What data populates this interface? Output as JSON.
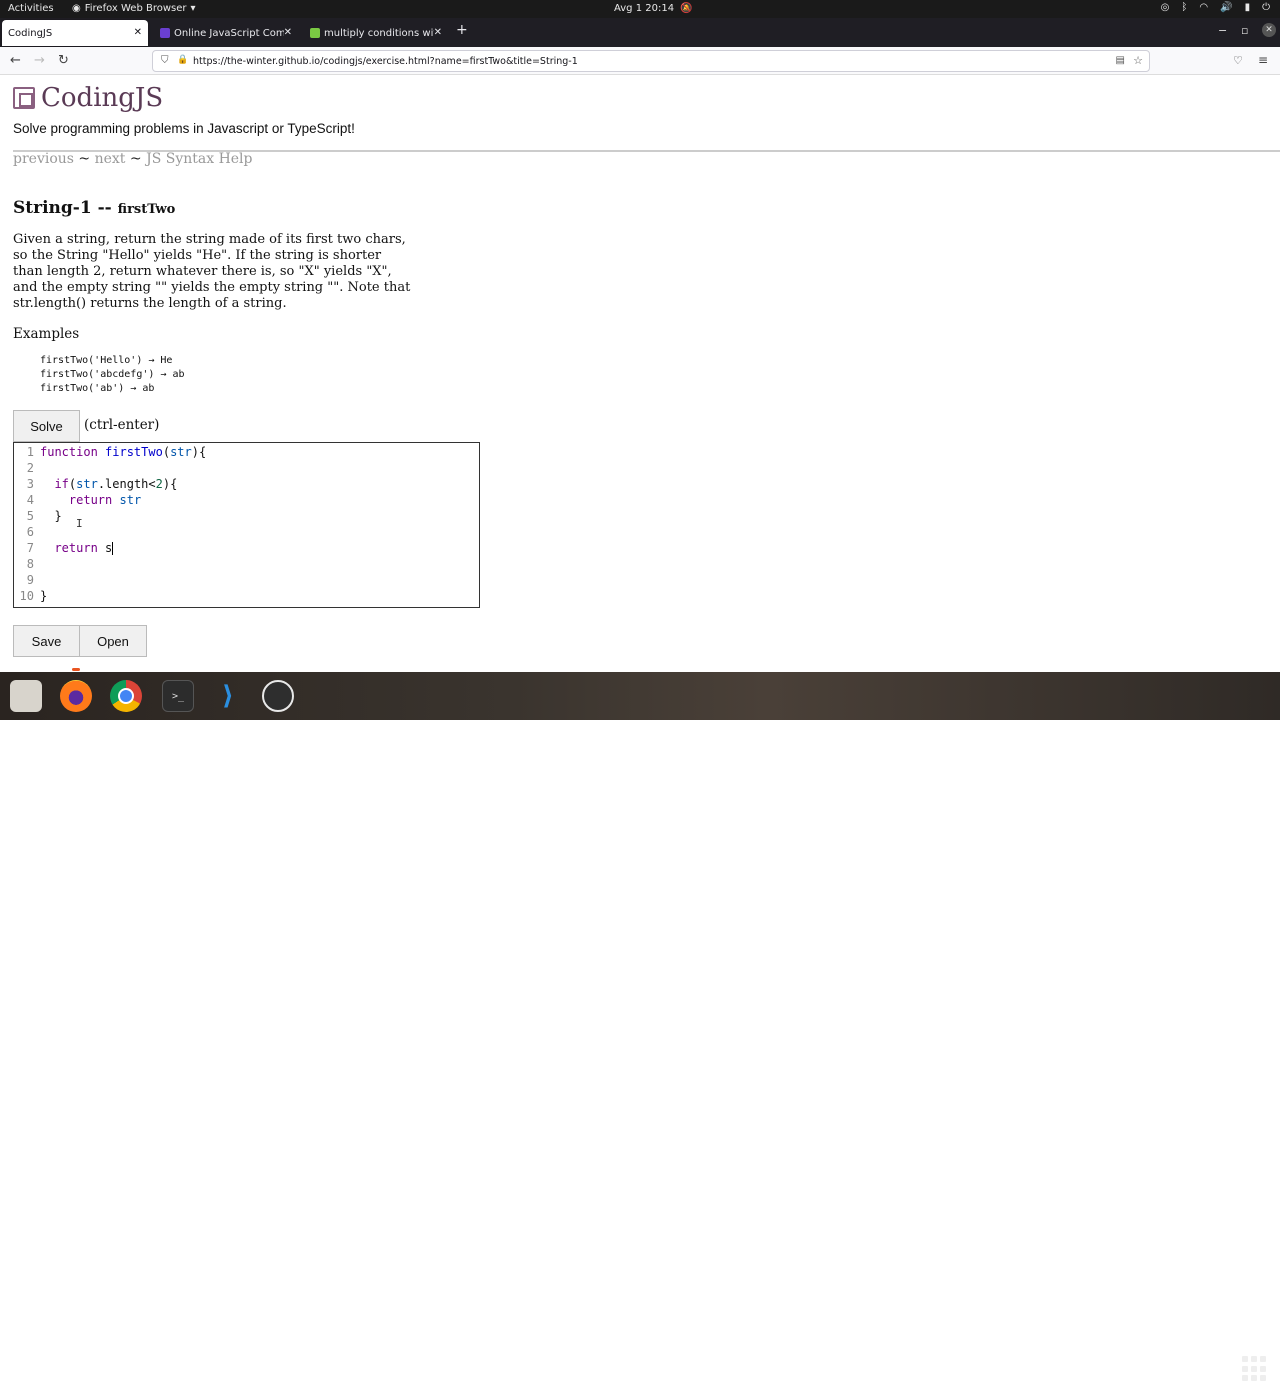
{
  "topbar": {
    "activities": "Activities",
    "app_name": "Firefox Web Browser",
    "clock": "Avg 1  20:14"
  },
  "tabs": [
    {
      "label": "CodingJS",
      "active": true
    },
    {
      "label": "Online JavaScript Compil",
      "active": false
    },
    {
      "label": "multiply conditions with",
      "active": false
    }
  ],
  "url": "https://the-winter.github.io/codingjs/exercise.html?name=firstTwo&title=String-1",
  "page": {
    "logo": "CodingJS",
    "tagline": "Solve programming problems in Javascript or TypeScript!",
    "nav": {
      "previous": "previous",
      "sep1": "~",
      "next": "next",
      "sep2": "~",
      "help": "JS Syntax Help"
    },
    "title_main": "String-1 -- ",
    "title_name": "firstTwo",
    "description": "Given a string, return the string made of its first two chars, so the String \"Hello\" yields \"He\". If the string is shorter than length 2, return whatever there is, so \"X\" yields \"X\", and the empty string \"\" yields the empty string \"\". Note that str.length() returns the length of a string.",
    "examples_label": "Examples",
    "examples": [
      "firstTwo('Hello') → He",
      "firstTwo('abcdefg') → ab",
      "firstTwo('ab') → ab"
    ],
    "solve_label": "Solve",
    "solve_hint": "(ctrl-enter)",
    "save_label": "Save",
    "open_label": "Open"
  },
  "editor": {
    "line_numbers": [
      "1",
      "2",
      "3",
      "4",
      "5",
      "6",
      "7",
      "8",
      "9",
      "10"
    ]
  },
  "dock": {
    "terminal_glyph": ">_"
  }
}
